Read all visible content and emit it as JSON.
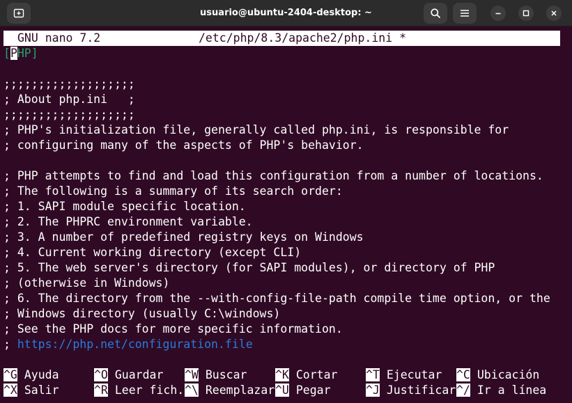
{
  "window": {
    "title": "usuario@ubuntu-2404-desktop: ~",
    "icons": [
      "new-tab-icon",
      "search-icon",
      "hamburger-menu-icon",
      "minimize-icon",
      "maximize-icon",
      "close-icon"
    ]
  },
  "nano": {
    "version": "GNU nano 7.2",
    "filename": "/etc/php/8.3/apache2/php.ini *"
  },
  "content": {
    "section_open": "[",
    "section_cursor": "P",
    "section_rest": "HP]",
    "lines": [
      ";;;;;;;;;;;;;;;;;;;",
      "; About php.ini   ;",
      ";;;;;;;;;;;;;;;;;;;",
      "; PHP's initialization file, generally called php.ini, is responsible for",
      "; configuring many of the aspects of PHP's behavior.",
      "",
      "; PHP attempts to find and load this configuration from a number of locations.",
      "; The following is a summary of its search order:",
      "; 1. SAPI module specific location.",
      "; 2. The PHPRC environment variable.",
      "; 3. A number of predefined registry keys on Windows",
      "; 4. Current working directory (except CLI)",
      "; 5. The web server's directory (for SAPI modules), or directory of PHP",
      "; (otherwise in Windows)",
      "; 6. The directory from the --with-config-file-path compile time option, or the",
      "; Windows directory (usually C:\\windows)",
      "; See the PHP docs for more specific information."
    ],
    "link_prefix": "; ",
    "link": "https://php.net/configuration.file"
  },
  "shortcuts": [
    [
      {
        "key": "^G",
        "label": "Ayuda"
      },
      {
        "key": "^O",
        "label": "Guardar"
      },
      {
        "key": "^W",
        "label": "Buscar"
      },
      {
        "key": "^K",
        "label": "Cortar"
      },
      {
        "key": "^T",
        "label": "Ejecutar"
      },
      {
        "key": "^C",
        "label": "Ubicación"
      }
    ],
    [
      {
        "key": "^X",
        "label": "Salir"
      },
      {
        "key": "^R",
        "label": "Leer fich."
      },
      {
        "key": "^\\",
        "label": "Reemplazar"
      },
      {
        "key": "^U",
        "label": "Pegar"
      },
      {
        "key": "^J",
        "label": "Justificar"
      },
      {
        "key": "^/",
        "label": "Ir a línea"
      }
    ]
  ],
  "colors": {
    "background": "#300a24",
    "foreground": "#ffffff",
    "section": "#26a269",
    "link": "#2a7bde",
    "titlebar": "#2c2c2c"
  }
}
